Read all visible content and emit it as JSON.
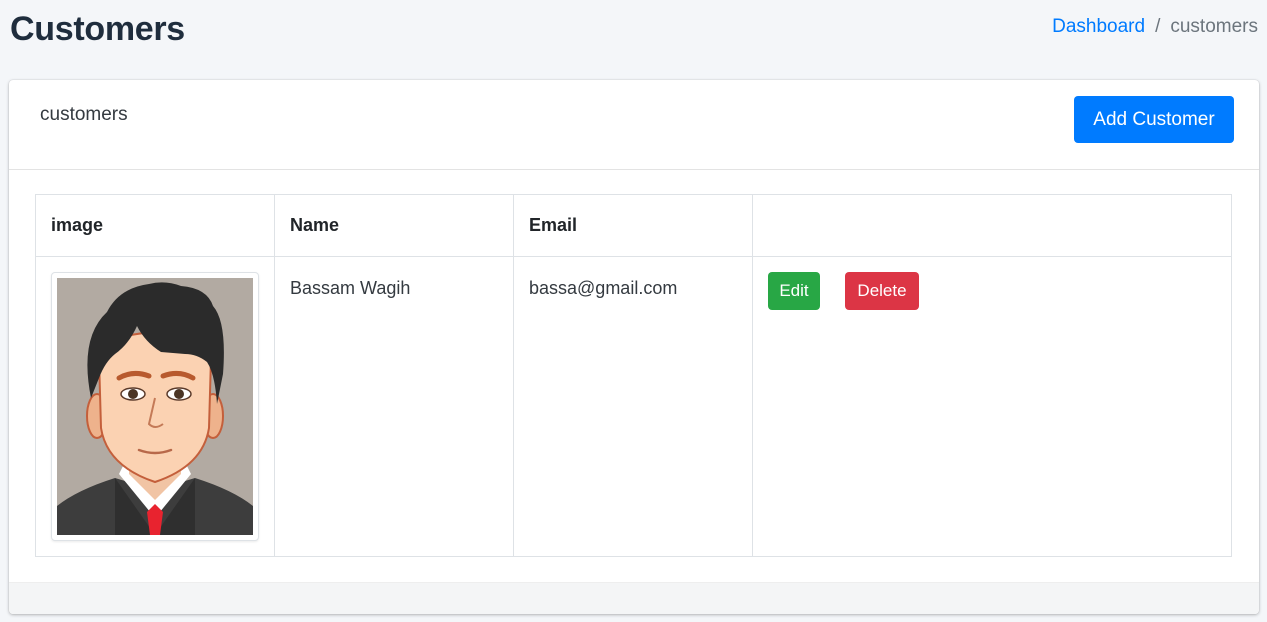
{
  "header": {
    "title": "Customers",
    "breadcrumb": {
      "home": "Dashboard",
      "separator": "/",
      "current": "customers"
    }
  },
  "card": {
    "title": "customers",
    "add_button": "Add Customer"
  },
  "table": {
    "columns": [
      "image",
      "Name",
      "Email",
      ""
    ],
    "rows": [
      {
        "image_icon": "customer-avatar",
        "name": "Bassam Wagih",
        "email": "bassa@gmail.com",
        "edit": "Edit",
        "delete": "Delete"
      }
    ]
  },
  "colors": {
    "primary": "#007bff",
    "success": "#28a745",
    "danger": "#dc3545"
  }
}
